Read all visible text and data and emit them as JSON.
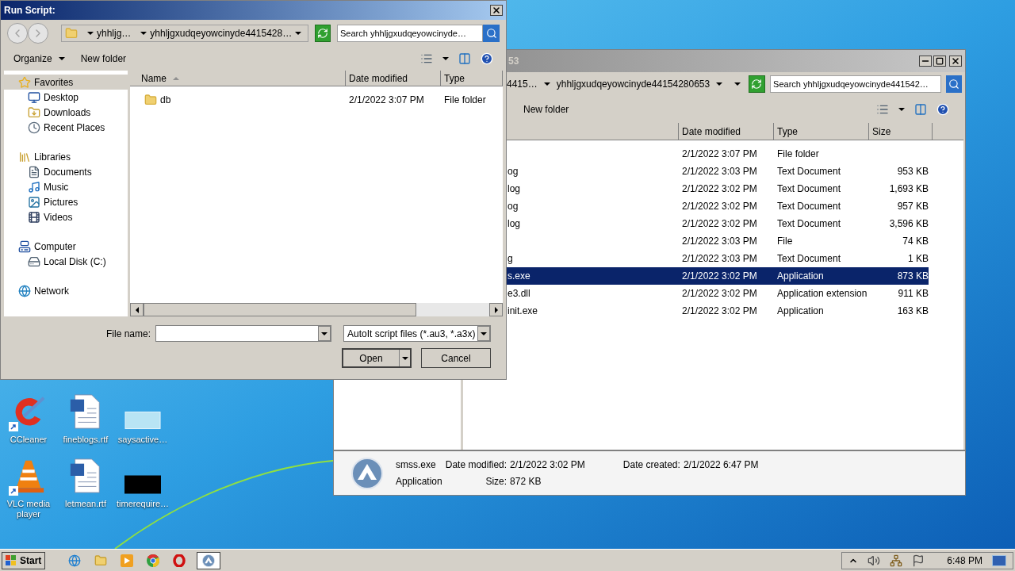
{
  "dialog": {
    "title": "Run Script:",
    "crumbs": [
      "yhhljg…",
      "yhhljgxudqeyowcinyde4415428…"
    ],
    "search": {
      "placeholder": "Search yhhljgxudqeyowcinyde…"
    },
    "toolbar": [
      {
        "label": "Organize",
        "menu": true
      },
      {
        "label": "New folder",
        "menu": false
      }
    ],
    "nav": [
      {
        "label": "Favorites",
        "kind": "star",
        "selected": true,
        "children": [
          {
            "label": "Desktop",
            "kind": "desktop",
            "selected": false
          },
          {
            "label": "Downloads",
            "kind": "downloads",
            "selected": false
          },
          {
            "label": "Recent Places",
            "kind": "recent",
            "selected": false
          }
        ]
      },
      {
        "label": "Libraries",
        "kind": "library",
        "selected": false,
        "children": [
          {
            "label": "Documents",
            "kind": "documents",
            "selected": false
          },
          {
            "label": "Music",
            "kind": "music",
            "selected": false
          },
          {
            "label": "Pictures",
            "kind": "pictures",
            "selected": false
          },
          {
            "label": "Videos",
            "kind": "videos",
            "selected": false
          }
        ]
      },
      {
        "label": "Computer",
        "kind": "computer",
        "selected": false,
        "children": [
          {
            "label": "Local Disk (C:)",
            "kind": "disk",
            "selected": false
          }
        ]
      },
      {
        "label": "Network",
        "kind": "network",
        "selected": false
      }
    ],
    "columns": [
      {
        "label": "Name",
        "sorted": true
      },
      {
        "label": "Date modified",
        "sorted": false
      },
      {
        "label": "Type",
        "sorted": false
      }
    ],
    "rows": [
      {
        "name": "db",
        "date": "2/1/2022 3:07 PM",
        "type": "File folder",
        "kind": "folder"
      }
    ],
    "file_name_label": "File name:",
    "filter": "AutoIt script files (*.au3, *.a3x)",
    "buttons": [
      {
        "label": "Open",
        "split": true
      },
      {
        "label": "Cancel",
        "split": false
      }
    ]
  },
  "explorer": {
    "title": "53",
    "crumbs": [
      "4415…",
      "yhhljgxudqeyowcinyde44154280653"
    ],
    "search": {
      "placeholder": "Search yhhljgxudqeyowcinyde441542…"
    },
    "toolbar": [
      "New folder"
    ],
    "columns": [
      "Date modified",
      "Type",
      "Size"
    ],
    "rows": [
      {
        "name": "",
        "date": "2/1/2022 3:07 PM",
        "type": "File folder",
        "size": "",
        "selected": false
      },
      {
        "name": "og",
        "date": "2/1/2022 3:03 PM",
        "type": "Text Document",
        "size": "953 KB",
        "selected": false
      },
      {
        "name": "log",
        "date": "2/1/2022 3:02 PM",
        "type": "Text Document",
        "size": "1,693 KB",
        "selected": false
      },
      {
        "name": "og",
        "date": "2/1/2022 3:02 PM",
        "type": "Text Document",
        "size": "957 KB",
        "selected": false
      },
      {
        "name": "log",
        "date": "2/1/2022 3:02 PM",
        "type": "Text Document",
        "size": "3,596 KB",
        "selected": false
      },
      {
        "name": "",
        "date": "2/1/2022 3:03 PM",
        "type": "File",
        "size": "74 KB",
        "selected": false
      },
      {
        "name": "g",
        "date": "2/1/2022 3:03 PM",
        "type": "Text Document",
        "size": "1 KB",
        "selected": false
      },
      {
        "name": "s.exe",
        "date": "2/1/2022 3:02 PM",
        "type": "Application",
        "size": "873 KB",
        "selected": true
      },
      {
        "name": "e3.dll",
        "date": "2/1/2022 3:02 PM",
        "type": "Application extension",
        "size": "911 KB",
        "selected": false
      },
      {
        "name": "init.exe",
        "date": "2/1/2022 3:02 PM",
        "type": "Application",
        "size": "163 KB",
        "selected": false
      }
    ],
    "details": {
      "name": "smss.exe",
      "type": "Application",
      "modified_label": "Date modified:",
      "modified": "2/1/2022 3:02 PM",
      "created_label": "Date created:",
      "created": "2/1/2022 6:47 PM",
      "size_label": "Size:",
      "size": "872 KB"
    }
  },
  "desktop_icons": [
    {
      "label": "CCleaner",
      "kind": "ccleaner",
      "shortcut": true
    },
    {
      "label": "fineblogs.rtf",
      "kind": "word",
      "shortcut": false
    },
    {
      "label": "saysactive…",
      "kind": "blank",
      "shortcut": false
    },
    {
      "label": "VLC media player",
      "kind": "vlc",
      "shortcut": true
    },
    {
      "label": "letmean.rtf",
      "kind": "word",
      "shortcut": false
    },
    {
      "label": "timerequire…",
      "kind": "black",
      "shortcut": false
    }
  ],
  "taskbar": {
    "start": "Start",
    "apps": [
      {
        "kind": "ie",
        "selected": false
      },
      {
        "kind": "explorer",
        "selected": false
      },
      {
        "kind": "media",
        "selected": false
      },
      {
        "kind": "chrome",
        "selected": false
      },
      {
        "kind": "opera",
        "selected": false
      },
      {
        "kind": "autoit",
        "selected": true
      }
    ],
    "clock": "6:48 PM"
  }
}
